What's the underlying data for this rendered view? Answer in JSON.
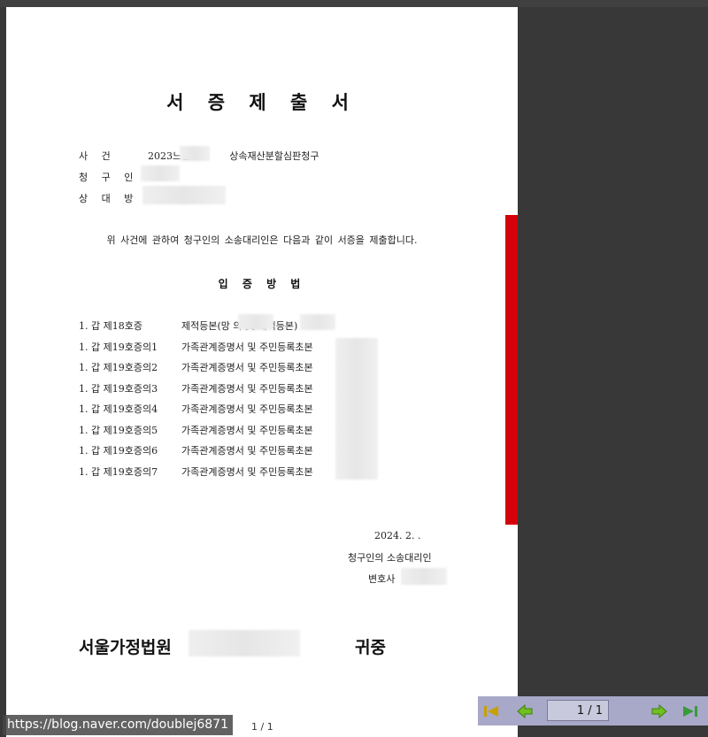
{
  "document": {
    "title": "서 증 제 출 서",
    "case_label": "사 건",
    "case_number": "2023느합",
    "case_name": "상속재산분할심판청구",
    "claimant_label": "청 구 인",
    "respondent_label": "상 대 방",
    "intro_text": "위 사건에 관하여 청구인의 소송대리인은 다음과 같이 서증을 제출합니다.",
    "section_title": "입 증 방 법",
    "evidence": [
      {
        "id": "1. 갑 제18호증",
        "desc": "제적등본(망       의 夫          제적등본)"
      },
      {
        "id": "1. 갑 제19호증의1",
        "desc": "가족관계증명서 및 주민등록초본"
      },
      {
        "id": "1. 갑 제19호증의2",
        "desc": "가족관계증명서 및 주민등록초본"
      },
      {
        "id": "1. 갑 제19호증의3",
        "desc": "가족관계증명서 및 주민등록초본"
      },
      {
        "id": "1. 갑 제19호증의4",
        "desc": "가족관계증명서 및 주민등록초본"
      },
      {
        "id": "1. 갑 제19호증의5",
        "desc": "가족관계증명서 및 주민등록초본"
      },
      {
        "id": "1. 갑 제19호증의6",
        "desc": "가족관계증명서 및 주민등록초본"
      },
      {
        "id": "1. 갑 제19호증의7",
        "desc": "가족관계증명서 및 주민등록초본"
      }
    ],
    "date": "2024.   2.    .",
    "signature_role": "청구인의 소송대리인",
    "signature_title": "변호사",
    "court": "서울가정법원",
    "court_suffix": "귀중",
    "page_footer": "1 / 1"
  },
  "toolbar": {
    "page_indicator": "1 / 1",
    "colors": {
      "first": "#c8a000",
      "prev": "#6fbf1f",
      "next": "#6fbf1f",
      "last": "#3a9a3a"
    }
  },
  "watermark": "https://blog.naver.com/doublej6871",
  "colors": {
    "scroll_marker": "#d4000b",
    "background": "#383838",
    "toolbar": "#a8a8c8"
  }
}
